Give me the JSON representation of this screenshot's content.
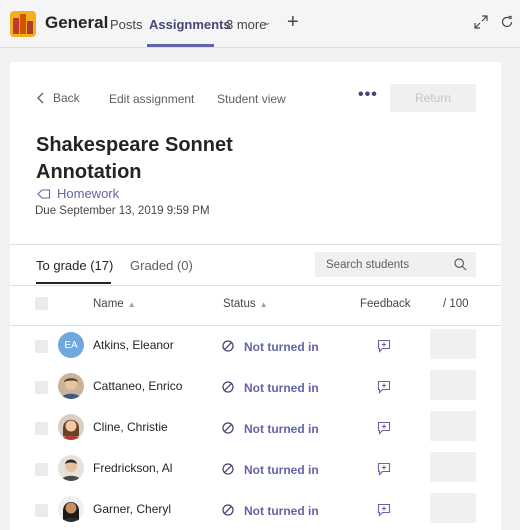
{
  "header": {
    "channel": "General",
    "tabs": [
      "Posts",
      "Assignments",
      "3 more"
    ]
  },
  "toolbar": {
    "back": "Back",
    "edit": "Edit assignment",
    "student_view": "Student view",
    "more": "•••",
    "return": "Return"
  },
  "assignment": {
    "title": "Shakespeare Sonnet Annotation",
    "category": "Homework",
    "due": "Due September 13, 2019 9:59 PM"
  },
  "subtabs": {
    "to_grade": "To grade (17)",
    "graded": "Graded (0)"
  },
  "search": {
    "placeholder": "Search students"
  },
  "columns": {
    "name": "Name",
    "status": "Status",
    "feedback": "Feedback",
    "points": "/ 100"
  },
  "students": [
    {
      "name": "Atkins, Eleanor",
      "initials": "EA",
      "status": "Not turned in"
    },
    {
      "name": "Cattaneo, Enrico",
      "status": "Not turned in"
    },
    {
      "name": "Cline, Christie",
      "status": "Not turned in"
    },
    {
      "name": "Fredrickson, Al",
      "status": "Not turned in"
    },
    {
      "name": "Garner, Cheryl",
      "status": "Not turned in"
    }
  ],
  "colors": {
    "accent": "#6264a7",
    "avatar_initials_bg": "#6fa8dc"
  }
}
